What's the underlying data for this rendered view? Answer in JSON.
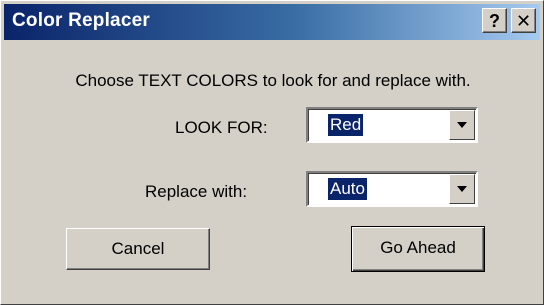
{
  "window": {
    "title": "Color Replacer",
    "help_label": "?",
    "close_label": "✕"
  },
  "prompt": "Choose TEXT COLORS to look for and replace with.",
  "look_for": {
    "label": "LOOK FOR:",
    "value": "Red"
  },
  "replace_with": {
    "label": "Replace with:",
    "value": "Auto"
  },
  "buttons": {
    "cancel": "Cancel",
    "go_ahead": "Go Ahead"
  }
}
